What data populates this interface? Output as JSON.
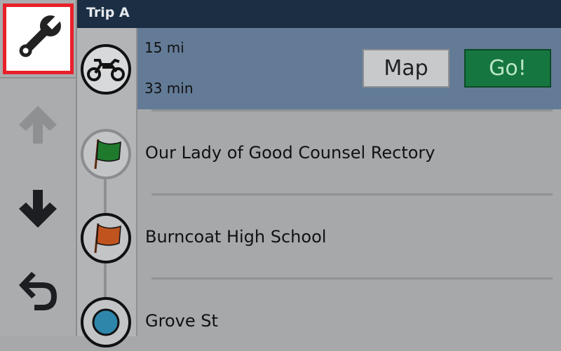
{
  "header": {
    "title": "Trip A"
  },
  "sidebar": {
    "tools_icon": "wrench-icon",
    "up_icon": "arrow-up-icon",
    "down_icon": "arrow-down-icon",
    "back_icon": "back-arrow-icon"
  },
  "route": {
    "vehicle_icon": "motorcycle-icon",
    "distance": "15 mi",
    "time": "33 min",
    "map_label": "Map",
    "go_label": "Go!"
  },
  "stops": [
    {
      "name": "Our Lady of Good Counsel Rectory",
      "icon": "green-flag-icon",
      "color": "#1f7a2e"
    },
    {
      "name": "Burncoat High School",
      "icon": "orange-flag-icon",
      "color": "#c0541f"
    },
    {
      "name": "Grove St",
      "icon": "blue-dot-icon",
      "color": "#2e86ab"
    }
  ],
  "colors": {
    "highlight_border": "#e8202a",
    "header_bg": "#1b2e44",
    "route_bg": "#637b96",
    "go_button": "#16763f"
  }
}
